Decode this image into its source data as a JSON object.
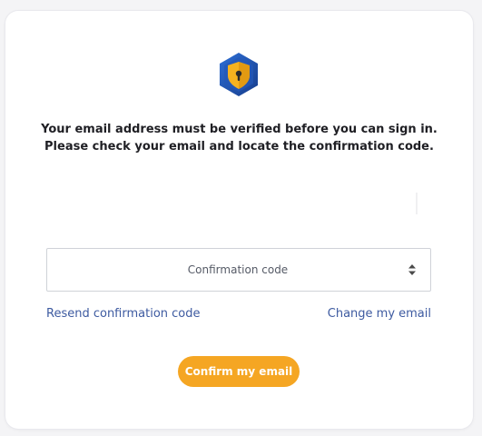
{
  "verification": {
    "logo_icon": "shield-lock-icon",
    "message_line1": "Your email address must be verified before you can sign in.",
    "message_line2": "Please check your email and locate the confirmation code.",
    "code_placeholder": "Confirmation code",
    "code_value": "",
    "resend_link": "Resend confirmation code",
    "change_email_link": "Change my email",
    "confirm_button": "Confirm my email"
  },
  "colors": {
    "accent": "#f5a623",
    "link": "#3d5aa0",
    "logo_outer": "#1e4fa8",
    "logo_shield": "#f5b21f"
  }
}
